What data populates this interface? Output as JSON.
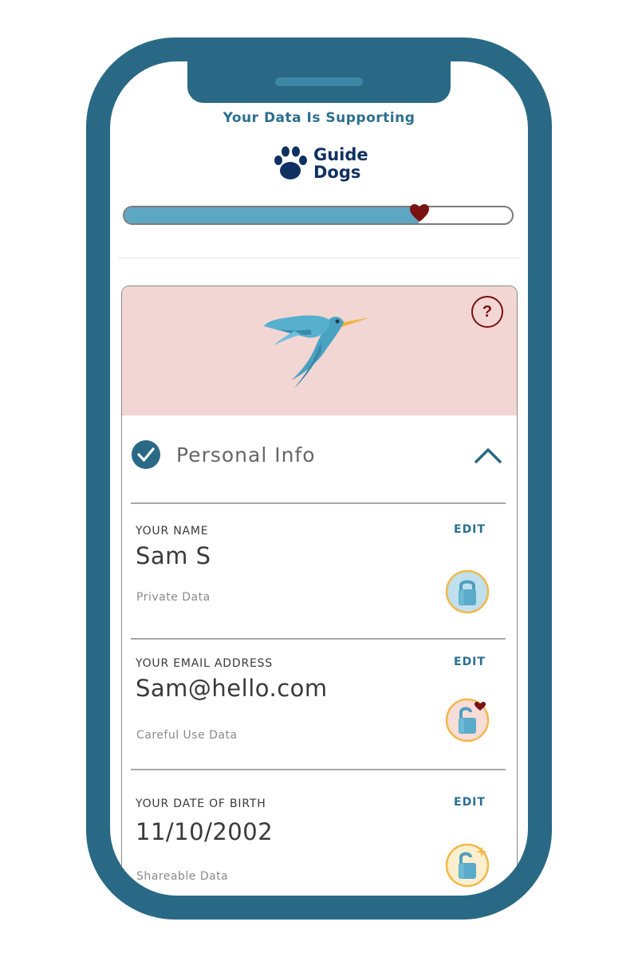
{
  "header": {
    "supporting_text": "Your Data Is Supporting",
    "charity": {
      "name_line1": "Guide",
      "name_line2": "Dogs",
      "logo_icon": "paw-icon"
    }
  },
  "progress": {
    "fraction": 0.76,
    "marker_icon": "heart-icon"
  },
  "card": {
    "hero_icon": "hummingbird-illustration",
    "help_label": "?",
    "section_title": "Personal Info",
    "fields": [
      {
        "label": "YOUR NAME",
        "edit_label": "EDIT",
        "value": "Sam S",
        "data_type": "Private Data",
        "badge_icon": "lock-closed-icon"
      },
      {
        "label": "YOUR EMAIL ADDRESS",
        "edit_label": "EDIT",
        "value": "Sam@hello.com",
        "data_type": "Careful Use Data",
        "badge_icon": "lock-open-heart-icon"
      },
      {
        "label": "YOUR DATE OF BIRTH",
        "edit_label": "EDIT",
        "value": "11/10/2002",
        "data_type": "Shareable Data",
        "badge_icon": "lock-open-sparkle-icon"
      }
    ]
  },
  "colors": {
    "frame": "#296985",
    "accent": "#2b6f8e",
    "progress_fill": "#5ea7c3",
    "heart": "#7a1212",
    "hero_bg": "#f2d6d3",
    "logo": "#0f3161"
  }
}
